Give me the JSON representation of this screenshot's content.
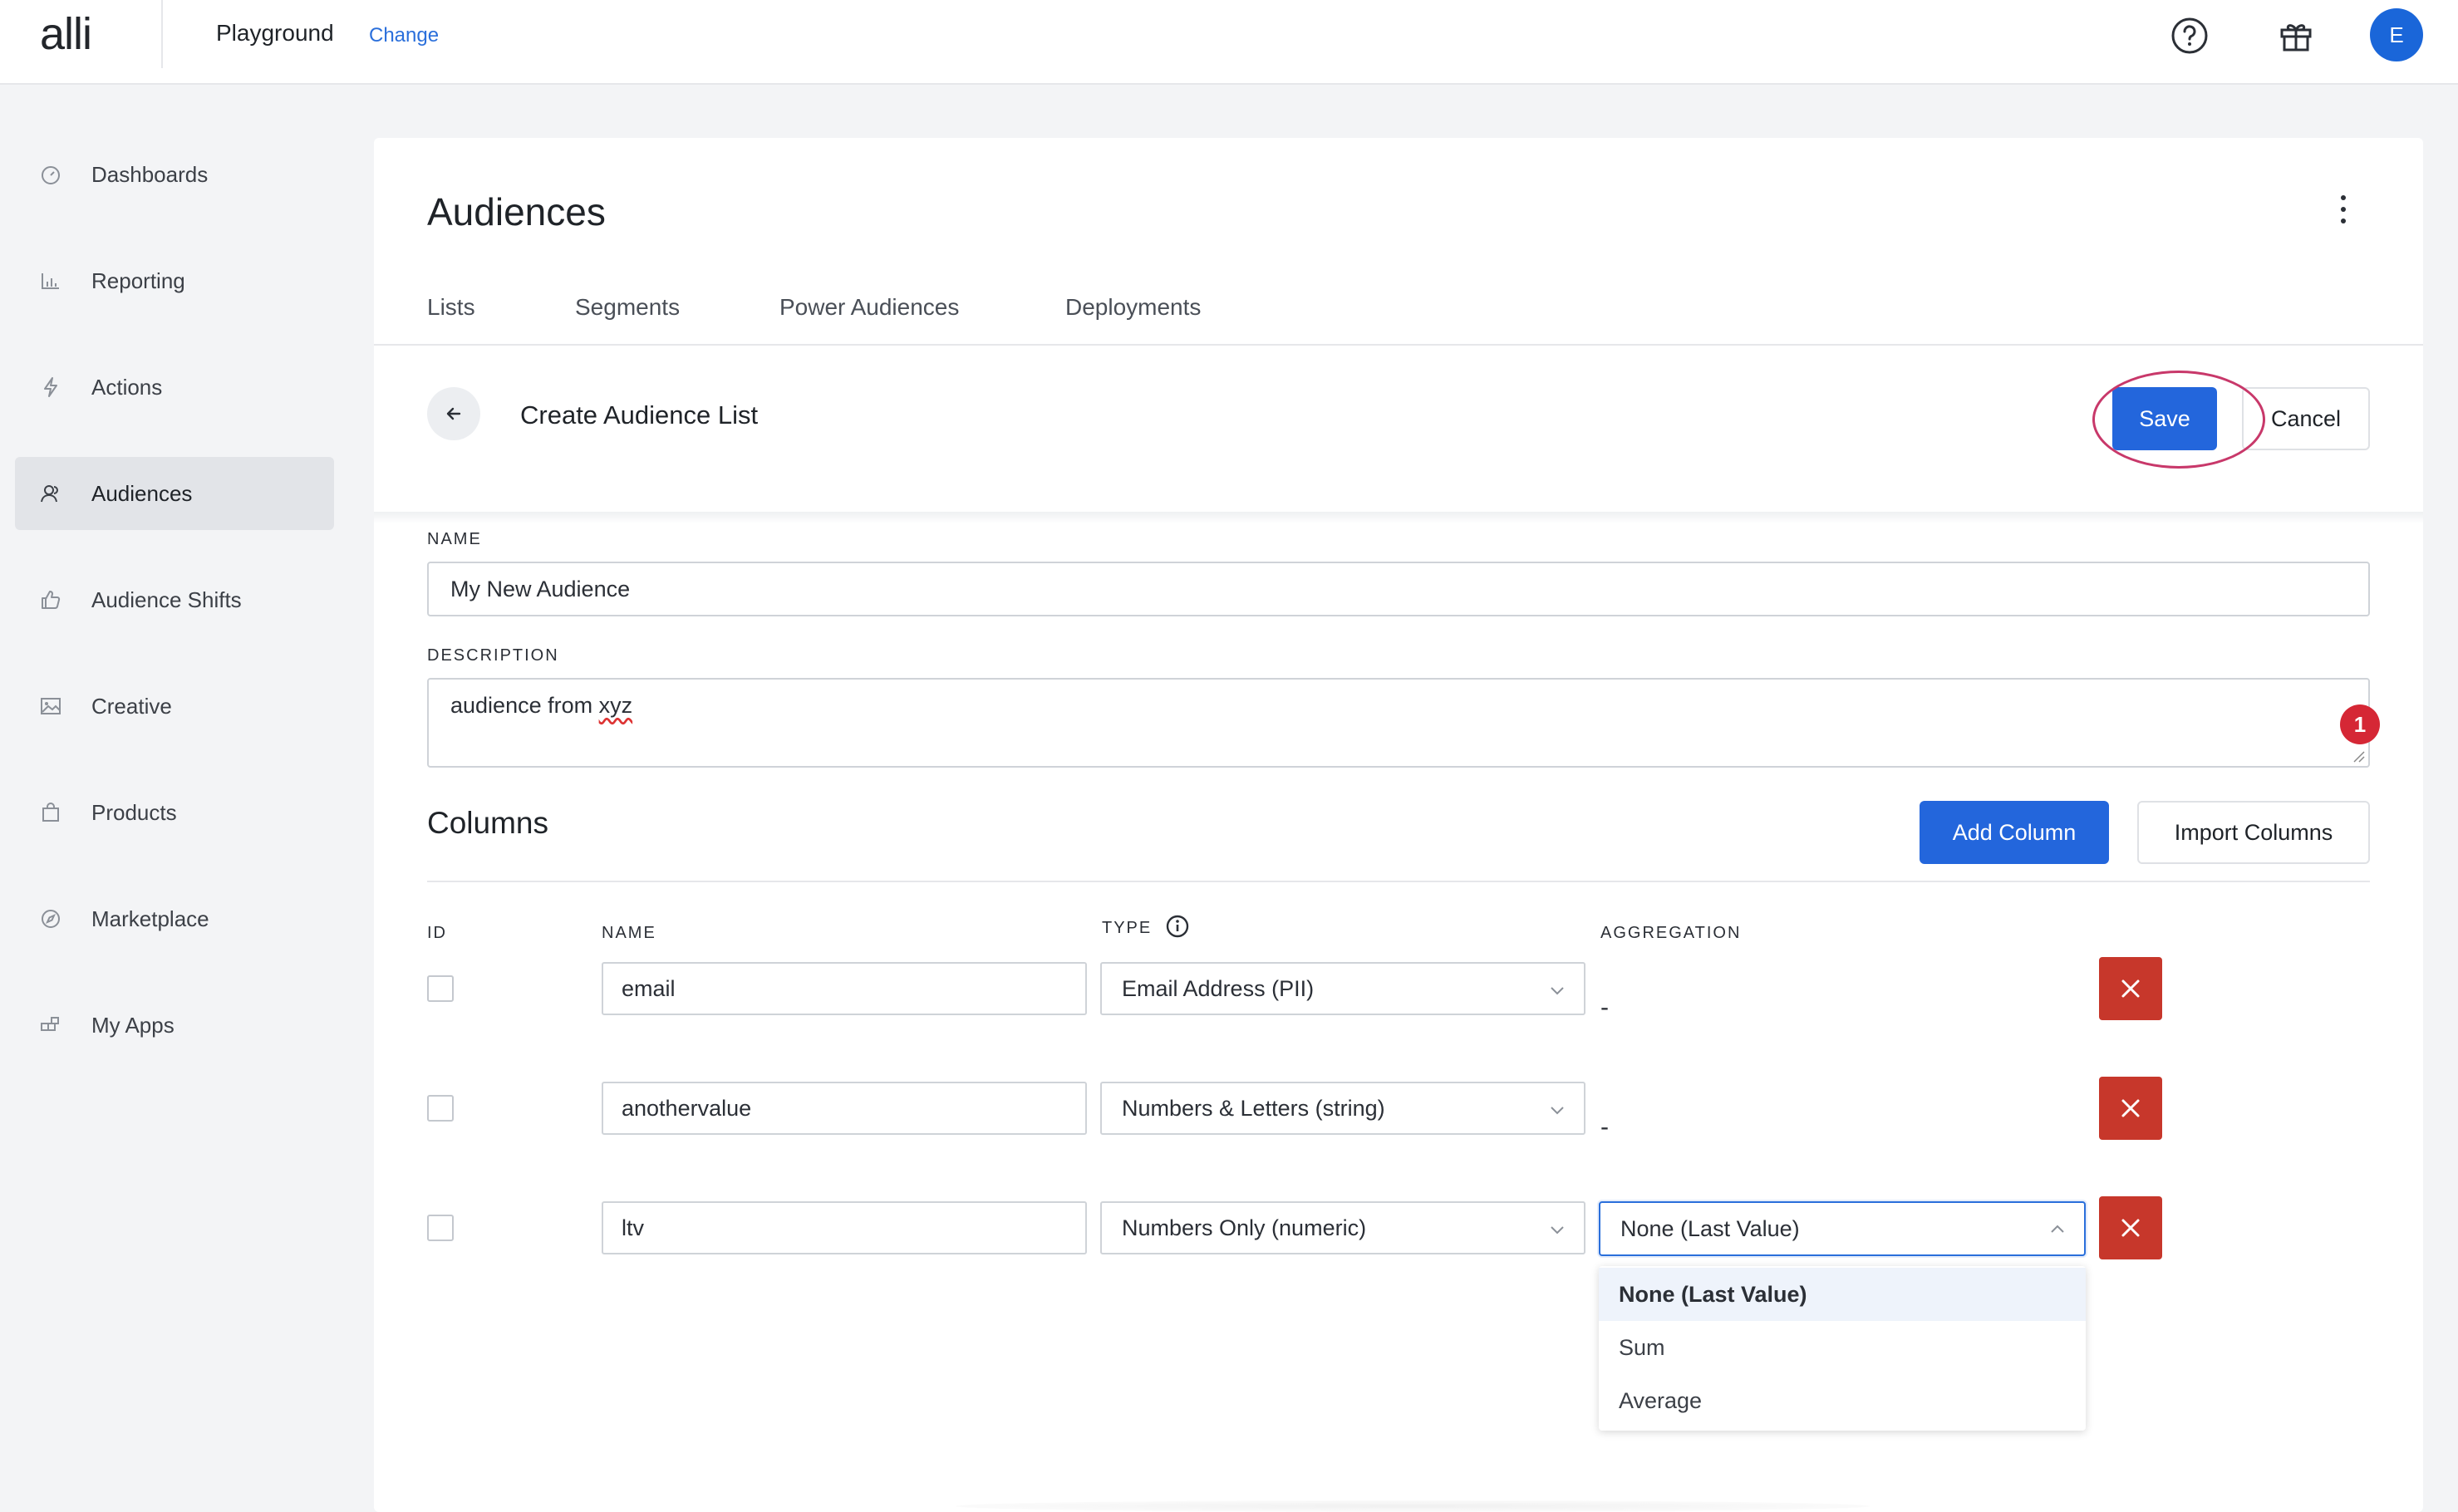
{
  "header": {
    "logo": "alli",
    "workspace": "Playground",
    "change_label": "Change",
    "avatar_initial": "E"
  },
  "sidebar": {
    "items": [
      {
        "label": "Dashboards",
        "icon": "dashboard-icon"
      },
      {
        "label": "Reporting",
        "icon": "bar-chart-icon"
      },
      {
        "label": "Actions",
        "icon": "lightning-icon"
      },
      {
        "label": "Audiences",
        "icon": "people-icon",
        "active": true
      },
      {
        "label": "Audience Shifts",
        "icon": "thumbs-up-icon"
      },
      {
        "label": "Creative",
        "icon": "image-icon"
      },
      {
        "label": "Products",
        "icon": "shopping-bag-icon"
      },
      {
        "label": "Marketplace",
        "icon": "compass-icon"
      },
      {
        "label": "My Apps",
        "icon": "apps-icon"
      }
    ]
  },
  "page": {
    "title": "Audiences",
    "tabs": [
      "Lists",
      "Segments",
      "Power Audiences",
      "Deployments"
    ],
    "subtitle": "Create Audience List",
    "save_label": "Save",
    "cancel_label": "Cancel"
  },
  "form": {
    "name_label": "NAME",
    "name_value": "My New Audience",
    "description_label": "DESCRIPTION",
    "description_prefix": "audience from ",
    "description_misspelled": "xyz",
    "error_count": "1"
  },
  "columns": {
    "title": "Columns",
    "add_label": "Add Column",
    "import_label": "Import Columns",
    "headers": {
      "id": "ID",
      "name": "NAME",
      "type": "TYPE",
      "aggregation": "AGGREGATION"
    },
    "rows": [
      {
        "name": "email",
        "type": "Email Address (PII)",
        "aggregation": "-"
      },
      {
        "name": "anothervalue",
        "type": "Numbers & Letters (string)",
        "aggregation": "-"
      },
      {
        "name": "ltv",
        "type": "Numbers Only (numeric)",
        "aggregation": "None (Last Value)"
      }
    ],
    "aggregation_options": [
      "None (Last Value)",
      "Sum",
      "Average"
    ]
  },
  "colors": {
    "primary": "#2366dc",
    "danger": "#c7372b",
    "highlight_ring": "#c8386a",
    "error_badge": "#d52735"
  }
}
